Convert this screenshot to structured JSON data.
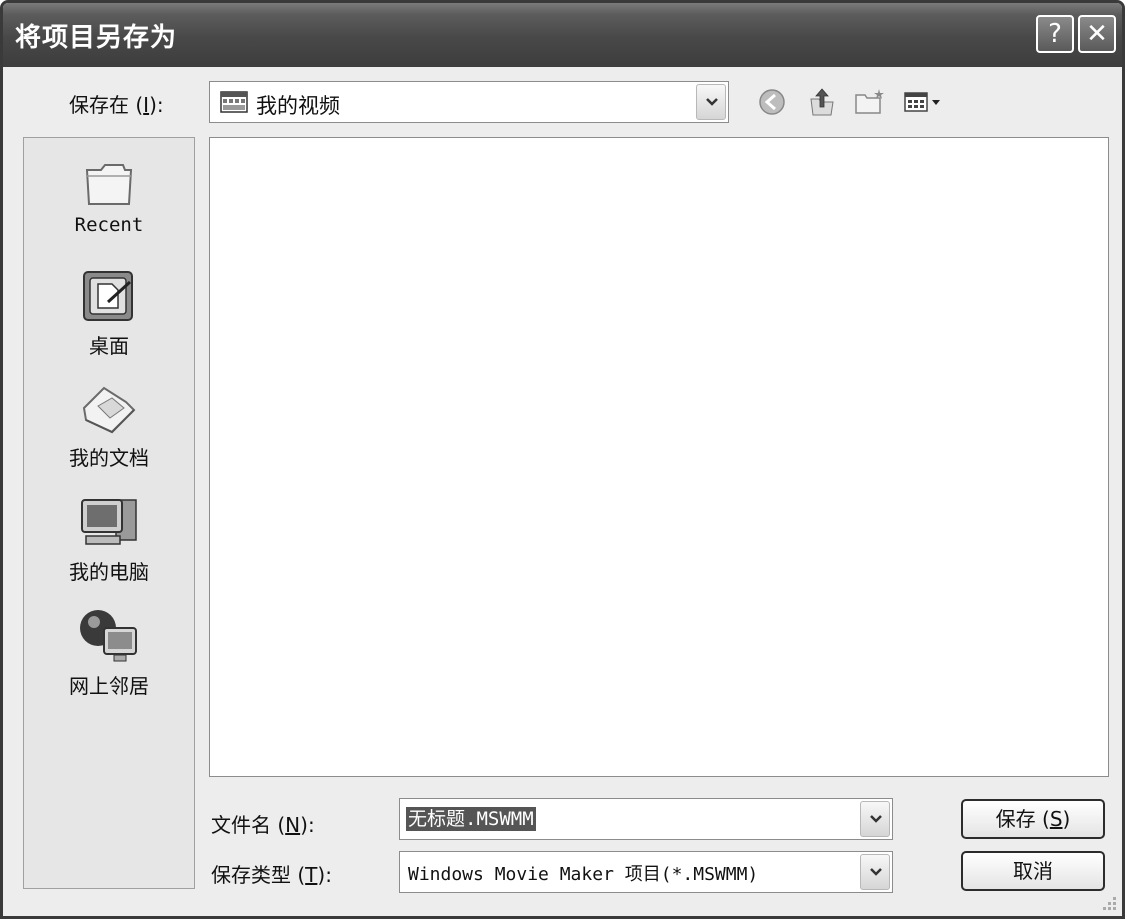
{
  "window": {
    "title": "将项目另存为",
    "help_glyph": "?",
    "close_glyph": "✕"
  },
  "save_in": {
    "label_prefix": "保存在 (",
    "label_key": "I",
    "label_suffix": "):",
    "value": "我的视频"
  },
  "toolbar": {
    "icons": [
      "back-icon",
      "up-folder-icon",
      "new-folder-icon",
      "views-menu-icon"
    ]
  },
  "places": [
    {
      "label": "Recent",
      "icon": "recent-icon"
    },
    {
      "label": "桌面",
      "icon": "desktop-icon"
    },
    {
      "label": "我的文档",
      "icon": "my-documents-icon"
    },
    {
      "label": "我的电脑",
      "icon": "my-computer-icon"
    },
    {
      "label": "网上邻居",
      "icon": "network-icon"
    }
  ],
  "file_name": {
    "label_prefix": "文件名 (",
    "label_key": "N",
    "label_suffix": "):",
    "value": "无标题.MSWMM"
  },
  "file_type": {
    "label_prefix": "保存类型 (",
    "label_key": "T",
    "label_suffix": "):",
    "value": "Windows Movie Maker 项目(*.MSWMM)"
  },
  "buttons": {
    "save_prefix": "保存 (",
    "save_key": "S",
    "save_suffix": ")",
    "cancel": "取消"
  },
  "colors": {
    "titlebar": "#484848",
    "dialog_bg": "#ededed",
    "selection": "#555555"
  }
}
